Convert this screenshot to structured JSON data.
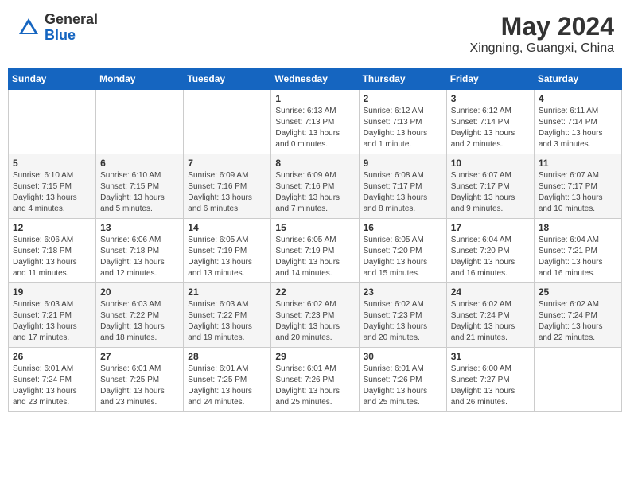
{
  "header": {
    "logo_general": "General",
    "logo_blue": "Blue",
    "month_year": "May 2024",
    "location": "Xingning, Guangxi, China"
  },
  "days_of_week": [
    "Sunday",
    "Monday",
    "Tuesday",
    "Wednesday",
    "Thursday",
    "Friday",
    "Saturday"
  ],
  "weeks": [
    [
      {
        "day": "",
        "info": ""
      },
      {
        "day": "",
        "info": ""
      },
      {
        "day": "",
        "info": ""
      },
      {
        "day": "1",
        "info": "Sunrise: 6:13 AM\nSunset: 7:13 PM\nDaylight: 13 hours\nand 0 minutes."
      },
      {
        "day": "2",
        "info": "Sunrise: 6:12 AM\nSunset: 7:13 PM\nDaylight: 13 hours\nand 1 minute."
      },
      {
        "day": "3",
        "info": "Sunrise: 6:12 AM\nSunset: 7:14 PM\nDaylight: 13 hours\nand 2 minutes."
      },
      {
        "day": "4",
        "info": "Sunrise: 6:11 AM\nSunset: 7:14 PM\nDaylight: 13 hours\nand 3 minutes."
      }
    ],
    [
      {
        "day": "5",
        "info": "Sunrise: 6:10 AM\nSunset: 7:15 PM\nDaylight: 13 hours\nand 4 minutes."
      },
      {
        "day": "6",
        "info": "Sunrise: 6:10 AM\nSunset: 7:15 PM\nDaylight: 13 hours\nand 5 minutes."
      },
      {
        "day": "7",
        "info": "Sunrise: 6:09 AM\nSunset: 7:16 PM\nDaylight: 13 hours\nand 6 minutes."
      },
      {
        "day": "8",
        "info": "Sunrise: 6:09 AM\nSunset: 7:16 PM\nDaylight: 13 hours\nand 7 minutes."
      },
      {
        "day": "9",
        "info": "Sunrise: 6:08 AM\nSunset: 7:17 PM\nDaylight: 13 hours\nand 8 minutes."
      },
      {
        "day": "10",
        "info": "Sunrise: 6:07 AM\nSunset: 7:17 PM\nDaylight: 13 hours\nand 9 minutes."
      },
      {
        "day": "11",
        "info": "Sunrise: 6:07 AM\nSunset: 7:17 PM\nDaylight: 13 hours\nand 10 minutes."
      }
    ],
    [
      {
        "day": "12",
        "info": "Sunrise: 6:06 AM\nSunset: 7:18 PM\nDaylight: 13 hours\nand 11 minutes."
      },
      {
        "day": "13",
        "info": "Sunrise: 6:06 AM\nSunset: 7:18 PM\nDaylight: 13 hours\nand 12 minutes."
      },
      {
        "day": "14",
        "info": "Sunrise: 6:05 AM\nSunset: 7:19 PM\nDaylight: 13 hours\nand 13 minutes."
      },
      {
        "day": "15",
        "info": "Sunrise: 6:05 AM\nSunset: 7:19 PM\nDaylight: 13 hours\nand 14 minutes."
      },
      {
        "day": "16",
        "info": "Sunrise: 6:05 AM\nSunset: 7:20 PM\nDaylight: 13 hours\nand 15 minutes."
      },
      {
        "day": "17",
        "info": "Sunrise: 6:04 AM\nSunset: 7:20 PM\nDaylight: 13 hours\nand 16 minutes."
      },
      {
        "day": "18",
        "info": "Sunrise: 6:04 AM\nSunset: 7:21 PM\nDaylight: 13 hours\nand 16 minutes."
      }
    ],
    [
      {
        "day": "19",
        "info": "Sunrise: 6:03 AM\nSunset: 7:21 PM\nDaylight: 13 hours\nand 17 minutes."
      },
      {
        "day": "20",
        "info": "Sunrise: 6:03 AM\nSunset: 7:22 PM\nDaylight: 13 hours\nand 18 minutes."
      },
      {
        "day": "21",
        "info": "Sunrise: 6:03 AM\nSunset: 7:22 PM\nDaylight: 13 hours\nand 19 minutes."
      },
      {
        "day": "22",
        "info": "Sunrise: 6:02 AM\nSunset: 7:23 PM\nDaylight: 13 hours\nand 20 minutes."
      },
      {
        "day": "23",
        "info": "Sunrise: 6:02 AM\nSunset: 7:23 PM\nDaylight: 13 hours\nand 20 minutes."
      },
      {
        "day": "24",
        "info": "Sunrise: 6:02 AM\nSunset: 7:24 PM\nDaylight: 13 hours\nand 21 minutes."
      },
      {
        "day": "25",
        "info": "Sunrise: 6:02 AM\nSunset: 7:24 PM\nDaylight: 13 hours\nand 22 minutes."
      }
    ],
    [
      {
        "day": "26",
        "info": "Sunrise: 6:01 AM\nSunset: 7:24 PM\nDaylight: 13 hours\nand 23 minutes."
      },
      {
        "day": "27",
        "info": "Sunrise: 6:01 AM\nSunset: 7:25 PM\nDaylight: 13 hours\nand 23 minutes."
      },
      {
        "day": "28",
        "info": "Sunrise: 6:01 AM\nSunset: 7:25 PM\nDaylight: 13 hours\nand 24 minutes."
      },
      {
        "day": "29",
        "info": "Sunrise: 6:01 AM\nSunset: 7:26 PM\nDaylight: 13 hours\nand 25 minutes."
      },
      {
        "day": "30",
        "info": "Sunrise: 6:01 AM\nSunset: 7:26 PM\nDaylight: 13 hours\nand 25 minutes."
      },
      {
        "day": "31",
        "info": "Sunrise: 6:00 AM\nSunset: 7:27 PM\nDaylight: 13 hours\nand 26 minutes."
      },
      {
        "day": "",
        "info": ""
      }
    ]
  ]
}
